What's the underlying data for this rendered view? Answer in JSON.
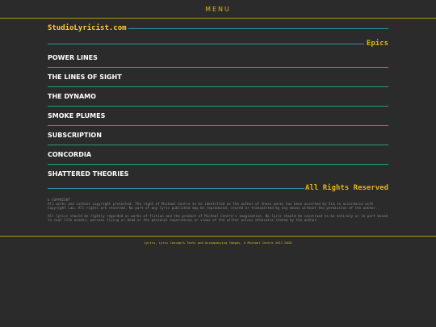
{
  "header": {
    "menu_label": "MENU"
  },
  "site": {
    "title": "StudioLyricist.com"
  },
  "section": {
    "label": "Epics"
  },
  "songs": [
    {
      "title": "POWER LINES"
    },
    {
      "title": "THE LINES OF SIGHT"
    },
    {
      "title": "THE DYNAMO"
    },
    {
      "title": "SMOKE PLUMES"
    },
    {
      "title": "SUBSCRIPTION"
    },
    {
      "title": "CONCORDIA"
    },
    {
      "title": "SHATTERED THEORIES"
    }
  ],
  "footer": {
    "label": "All Rights Reserved",
    "copyright_heading": "© COPYRIGHT",
    "paragraph1": "All works and content copyright protected. The right of Michael Centre to be identified as the author of these works has been asserted by him in accordance with Copyright Law. All rights are reserved. No part of any lyric published may be reproduced, stored or transmitted by any means without the permission of the author.",
    "paragraph2": "All lyrics should be rightly regarded as works of fiction and the product of Michael Centre's imagination. No lyric should be construed to be entirely or in part based in real life events, persons living or dead or the personal experiences or views of the writer unless otherwise stated by the author.",
    "bottom_note": "Lyrics, Lyric Concepts Texts and Accompanying Images, © Michael Centre 2017-2020"
  },
  "colors": {
    "background": "#2b2b2b",
    "accent": "#e0b51a",
    "teal_line": "#2f8f9e",
    "green_line": "#2e9b78"
  }
}
